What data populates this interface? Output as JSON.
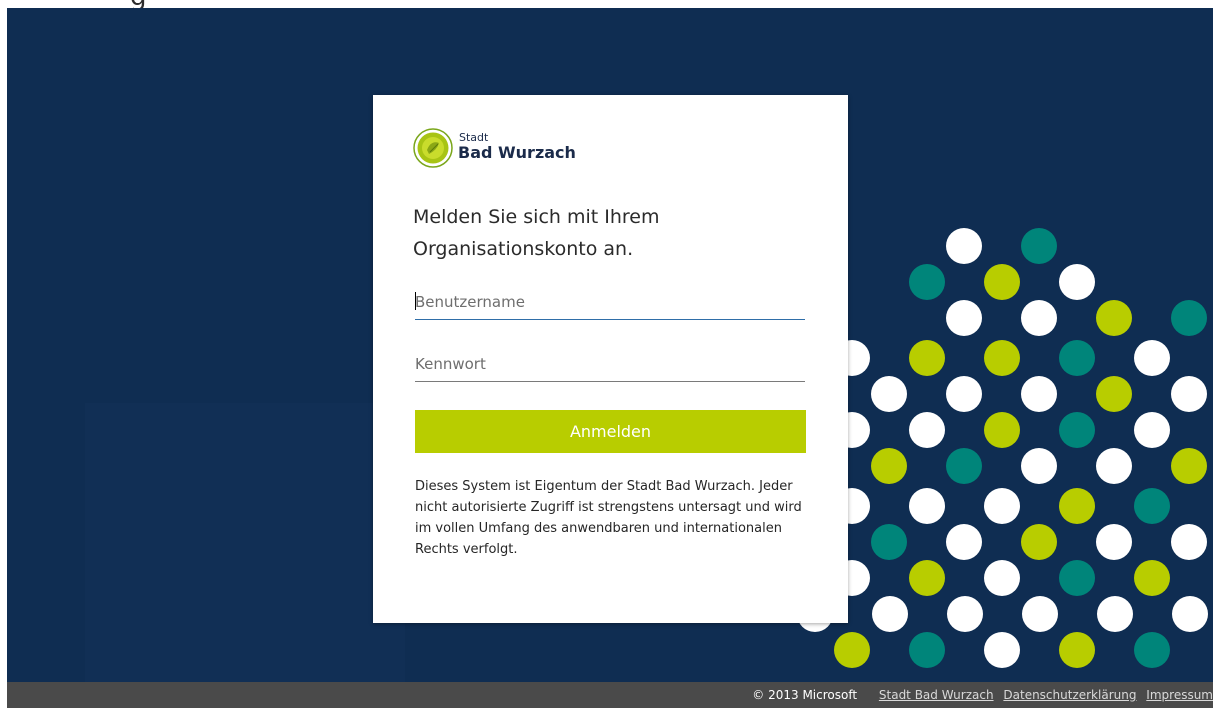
{
  "logo": {
    "small": "Stadt",
    "big": "Bad Wurzach"
  },
  "form": {
    "heading": "Melden Sie sich mit Ihrem Organisationskonto an.",
    "username_placeholder": "Benutzername",
    "password_placeholder": "Kennwort",
    "submit_label": "Anmelden",
    "notice": "Dieses System ist Eigentum der Stadt Bad Wurzach. Jeder nicht autorisierte Zugriff ist strengstens untersagt und wird im vollen Umfang des anwendbaren und internationalen Rechts verfolgt."
  },
  "footer": {
    "copyright": "© 2013 Microsoft",
    "links": [
      {
        "label": "Stadt Bad Wurzach"
      },
      {
        "label": "Datenschutzerklärung"
      },
      {
        "label": "Impressum"
      }
    ]
  },
  "colors": {
    "background": "#0f2d52",
    "accent": "#b8cd00",
    "teal": "#00857a",
    "dot_white": "#ffffff",
    "footer": "#4a4a4a"
  },
  "decoration": {
    "dot_colors": [
      "white",
      "teal",
      "lime"
    ]
  }
}
